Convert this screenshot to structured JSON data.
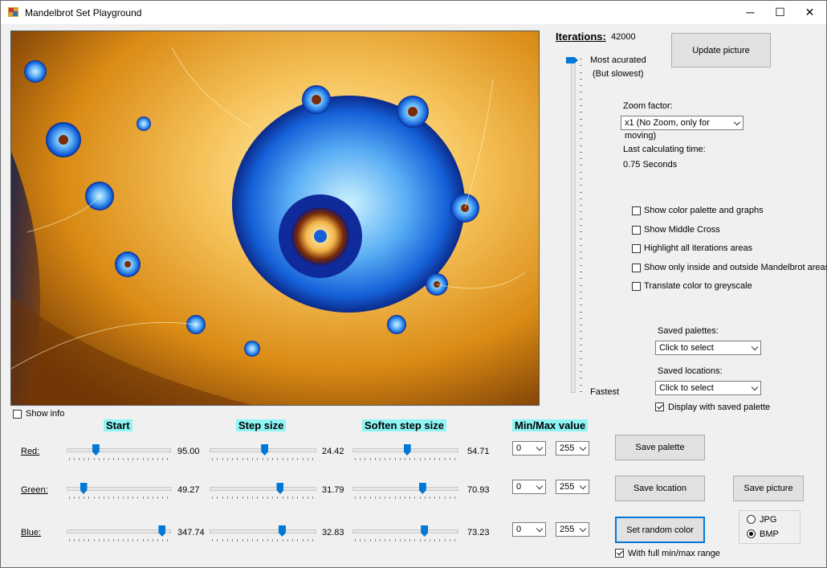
{
  "window": {
    "title": "Mandelbrot Set Playground",
    "minimize": "─",
    "maximize": "☐",
    "close": "✕"
  },
  "iterations": {
    "label": "Iterations:",
    "value": "42000",
    "slider_level": 1.0,
    "top_label_1": "Most acurated",
    "top_label_2": "(But slowest)",
    "bottom_label": "Fastest"
  },
  "update_button": "Update picture",
  "zoom": {
    "label": "Zoom factor:",
    "value": "x1 (No Zoom, only for moving)"
  },
  "calc": {
    "label": "Last calculating time:",
    "value": "0.75 Seconds"
  },
  "options": [
    {
      "label": "Show color palette and graphs",
      "checked": false
    },
    {
      "label": "Show Middle Cross",
      "checked": false
    },
    {
      "label": "Highlight all iterations areas",
      "checked": false
    },
    {
      "label": "Show only inside and outside Mandelbrot areas",
      "checked": false
    },
    {
      "label": "Translate color to greyscale",
      "checked": false
    }
  ],
  "saved_palettes": {
    "label": "Saved palettes:",
    "value": "Click to select"
  },
  "saved_locations": {
    "label": "Saved locations:",
    "value": "Click to select"
  },
  "display_saved_palette": {
    "label": "Display with saved palette",
    "checked": true
  },
  "show_info": {
    "label": "Show info",
    "checked": false
  },
  "headers": {
    "start": "Start",
    "step": "Step size",
    "soften": "Soften step size",
    "minmax": "Min/Max value"
  },
  "rows": [
    {
      "label": "Red:",
      "start": "95.00",
      "start_pos": 0.27,
      "step": "24.42",
      "step_pos": 0.53,
      "soften": "54.71",
      "soften_pos": 0.53,
      "min": "0",
      "max": "255"
    },
    {
      "label": "Green:",
      "start": "49.27",
      "start_pos": 0.14,
      "step": "31.79",
      "step_pos": 0.69,
      "soften": "70.93",
      "soften_pos": 0.69,
      "min": "0",
      "max": "255"
    },
    {
      "label": "Blue:",
      "start": "347.74",
      "start_pos": 0.97,
      "step": "32.83",
      "step_pos": 0.71,
      "soften": "73.23",
      "soften_pos": 0.71,
      "min": "0",
      "max": "255"
    }
  ],
  "buttons": {
    "save_palette": "Save  palette",
    "save_location": "Save location",
    "save_picture": "Save picture",
    "random_color": "Set random color"
  },
  "full_range": {
    "label": "With full min/max range",
    "checked": true
  },
  "format": {
    "jpg": "JPG",
    "bmp": "BMP",
    "selected": "BMP"
  },
  "colors": {
    "accent": "#0078d7",
    "header_bg": "#8ff4f4"
  }
}
